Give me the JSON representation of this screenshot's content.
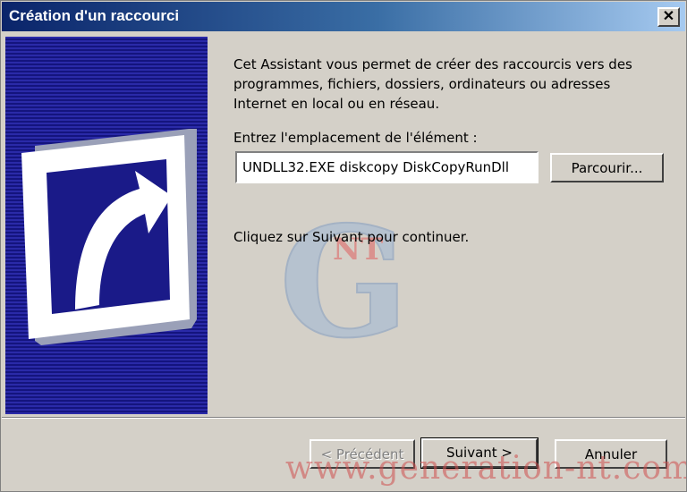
{
  "window": {
    "title": "Création d'un raccourci"
  },
  "titlebar": {
    "close_glyph": "✕"
  },
  "wizard": {
    "description": "Cet Assistant vous permet de créer des raccourcis vers des programmes, fichiers, dossiers, ordinateurs ou adresses Internet en local ou en réseau.",
    "location_label": "Entrez l'emplacement de l'élément :",
    "location_value": "UNDLL32.EXE diskcopy DiskCopyRunDll",
    "browse_label": "Parcourir...",
    "hint": "Cliquez sur Suivant pour continuer."
  },
  "buttons": {
    "prev_label": "< Précédent",
    "next_label": "Suivant >",
    "cancel_label": "Annuler"
  },
  "watermark": {
    "logo_letter": "G",
    "logo_small": "NT",
    "site": "www.generation-nt.com"
  },
  "icons": {
    "banner": "shortcut-arrow-icon",
    "close": "close-icon"
  },
  "colors": {
    "titlebar_start": "#0a246a",
    "titlebar_end": "#a6caf0",
    "banner_dark": "#14147e",
    "banner_light": "#2a2aa8",
    "dialog_bg": "#d4d0c8"
  }
}
